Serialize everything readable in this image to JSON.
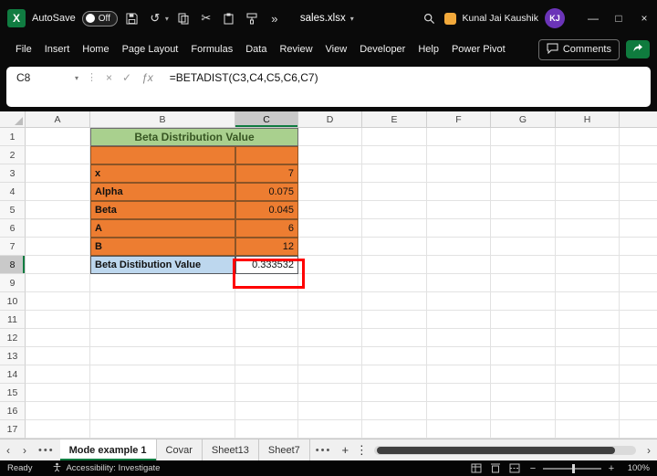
{
  "titlebar": {
    "autosave_label": "AutoSave",
    "autosave_state": "Off",
    "filename": "sales.xlsx",
    "user_name": "Kunal Jai Kaushik",
    "user_initials": "KJ"
  },
  "ribbon": {
    "tabs": [
      "File",
      "Insert",
      "Home",
      "Page Layout",
      "Formulas",
      "Data",
      "Review",
      "View",
      "Developer",
      "Help",
      "Power Pivot"
    ],
    "comments_label": "Comments"
  },
  "formula_bar": {
    "name_box": "C8",
    "fx_label": "ƒx",
    "formula": "=BETADIST(C3,C4,C5,C6,C7)"
  },
  "grid": {
    "column_headers": [
      "A",
      "B",
      "C",
      "D",
      "E",
      "F",
      "G",
      "H"
    ],
    "row_count": 17,
    "selected_cell": "C8",
    "selected_column": "C",
    "selected_row": 8,
    "cells": [
      {
        "ref": "B1",
        "text": "Beta Distribution Value",
        "style": "title",
        "colspan": 2
      },
      {
        "ref": "B2",
        "text": "",
        "style": "orange"
      },
      {
        "ref": "C2",
        "text": "",
        "style": "orange"
      },
      {
        "ref": "B3",
        "text": "x",
        "style": "orange-label"
      },
      {
        "ref": "C3",
        "text": "7",
        "style": "orange-value"
      },
      {
        "ref": "B4",
        "text": "Alpha",
        "style": "orange-label"
      },
      {
        "ref": "C4",
        "text": "0.075",
        "style": "orange-value"
      },
      {
        "ref": "B5",
        "text": "Beta",
        "style": "orange-label"
      },
      {
        "ref": "C5",
        "text": "0.045",
        "style": "orange-value"
      },
      {
        "ref": "B6",
        "text": "A",
        "style": "orange-label"
      },
      {
        "ref": "C6",
        "text": "6",
        "style": "orange-value"
      },
      {
        "ref": "B7",
        "text": "B",
        "style": "orange-label"
      },
      {
        "ref": "C7",
        "text": "12",
        "style": "orange-value"
      },
      {
        "ref": "B8",
        "text": "Beta Distibution Value",
        "style": "blue-label"
      },
      {
        "ref": "C8",
        "text": "0.333532",
        "style": "result-value"
      }
    ]
  },
  "sheet_tabs": {
    "tabs": [
      {
        "label": "Mode example 1",
        "active": true
      },
      {
        "label": "Covar",
        "active": false
      },
      {
        "label": "Sheet13",
        "active": false
      },
      {
        "label": "Sheet7",
        "active": false
      }
    ]
  },
  "status_bar": {
    "mode": "Ready",
    "accessibility": "Accessibility: Investigate",
    "zoom": "100%"
  },
  "icons": {
    "quick_access": [
      "save",
      "undo",
      "copy",
      "cut",
      "paste",
      "format-painter",
      "more-commands"
    ],
    "titlebar_right": [
      "search",
      "notification"
    ],
    "status_views": [
      "normal-view",
      "page-layout-view",
      "page-break-view"
    ]
  },
  "colors": {
    "title_cell_bg": "#A9D08E",
    "title_cell_text": "#375623",
    "orange_bg": "#ED7D31",
    "blue_bg": "#BDD7EE",
    "annotation_red": "#FF0000",
    "excel_green": "#107C41",
    "avatar_bg": "#6B34B8"
  }
}
